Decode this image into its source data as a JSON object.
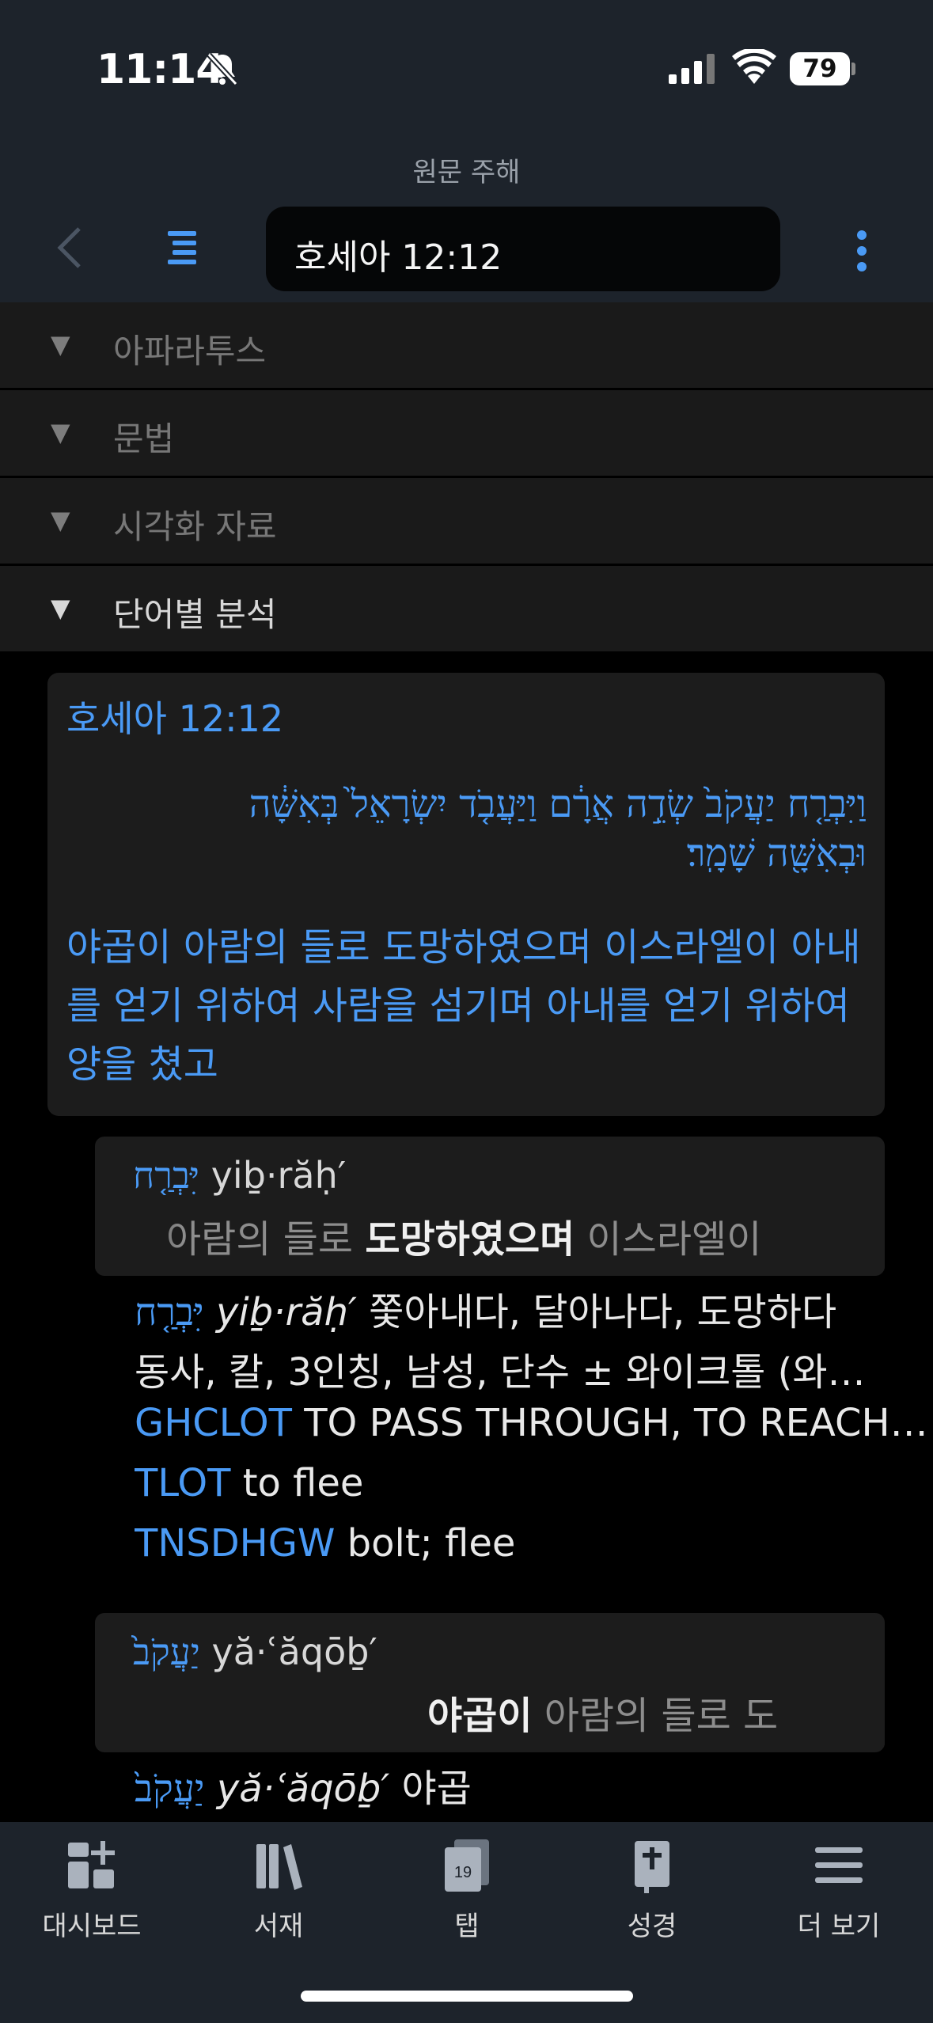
{
  "status": {
    "time": "11:14",
    "battery": "79"
  },
  "header": {
    "title": "원문 주해",
    "reference": "호세아 12:12"
  },
  "sections": [
    {
      "label": "아파라투스"
    },
    {
      "label": "문법"
    },
    {
      "label": "시각화 자료"
    },
    {
      "label": "단어별 분석"
    }
  ],
  "verse": {
    "reference": "호세아 12:12",
    "hebrew": "וַיִּבְרַ֤ח יַעֲקֹב֙ שְׂדֵ֣ה אֲרָ֔ם וַיַּעֲבֹ֤ד יִשְׂרָאֵל֙ בְּאִשָּׁ֔ה וּבְאִשָּׁ֖ה שָׁמָֽר׃",
    "translation": "야곱이 아람의 들로 도망하였으며 이스라엘이 아내를 얻기 위하여 사람을 섬기며 아내를 얻기 위하여 양을 쳤고"
  },
  "words": [
    {
      "hebrew": "יִּבְרַ֤ח",
      "translit": "yiḇ·răḥ′",
      "context_before": "아람의 들로 ",
      "context_bold": "도망하였으며",
      "context_after": " 이스라엘이",
      "gloss": "쫓아내다, 달아나다, 도망하다",
      "parsing": "동사, 칼, 3인칭, 남성, 단수 ± 와이크톨 (와…",
      "defs": [
        {
          "source": "GHCLOT",
          "text": "TO PASS THROUGH, TO REACH…"
        },
        {
          "source": "TLOT",
          "text": "to flee"
        },
        {
          "source": "TNSDHGW",
          "text": "bolt; flee"
        }
      ]
    },
    {
      "hebrew": "יַעֲקֹב֙",
      "translit": "yă·ʿăqōḇ′",
      "context_bold": "야곱이",
      "context_after": " 아람의 들로 도",
      "gloss": "야곱"
    }
  ],
  "tabs": [
    {
      "label": "대시보드",
      "icon": "dashboard-icon"
    },
    {
      "label": "서재",
      "icon": "library-icon"
    },
    {
      "label": "탭",
      "icon": "tabs-icon",
      "badge": "19"
    },
    {
      "label": "성경",
      "icon": "bible-icon"
    },
    {
      "label": "더 보기",
      "icon": "menu-icon"
    }
  ]
}
